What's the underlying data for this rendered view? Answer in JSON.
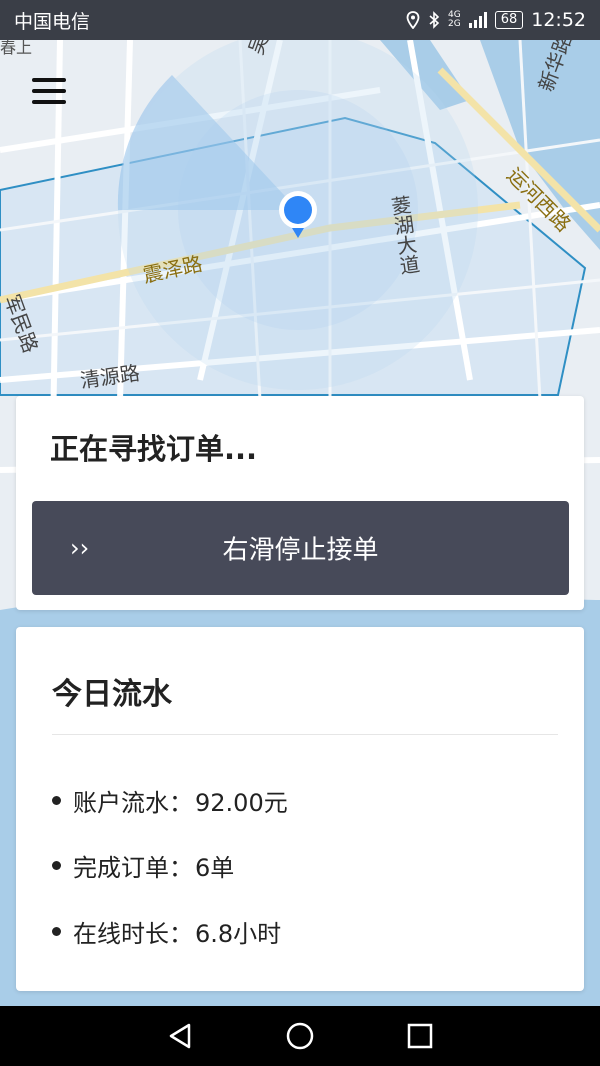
{
  "status_bar": {
    "carrier": "中国电信",
    "battery": "68",
    "net_top": "4G",
    "net_bottom": "2G",
    "time": "12:52"
  },
  "map": {
    "road_labels": {
      "wu_du": "吴都路",
      "xin_hua": "新华路",
      "yun_he_xi": "运河西路",
      "ling_hu": "菱湖大道",
      "zhen_ze": "震泽路",
      "jun_min": "军民路",
      "qing_yuan": "清源路",
      "partial_top": "春上"
    },
    "colors": {
      "water": "#a9cde8",
      "area_fill": "#d5e6f5",
      "boundary": "#2f8fc4",
      "location_blue": "#2f86f6"
    }
  },
  "order_card": {
    "title": "正在寻找订单...",
    "slider_arrows": "››",
    "slider_label": "右滑停止接单"
  },
  "earnings_card": {
    "title": "今日流水",
    "items": [
      {
        "label": "账户流水：",
        "value": "92.00元"
      },
      {
        "label": "完成订单：",
        "value": "6单"
      },
      {
        "label": "在线时长：",
        "value": "6.8小时"
      }
    ]
  },
  "nav_bar": {
    "back_icon": "back-triangle-icon",
    "home_icon": "home-circle-icon",
    "recents_icon": "recents-square-icon"
  }
}
